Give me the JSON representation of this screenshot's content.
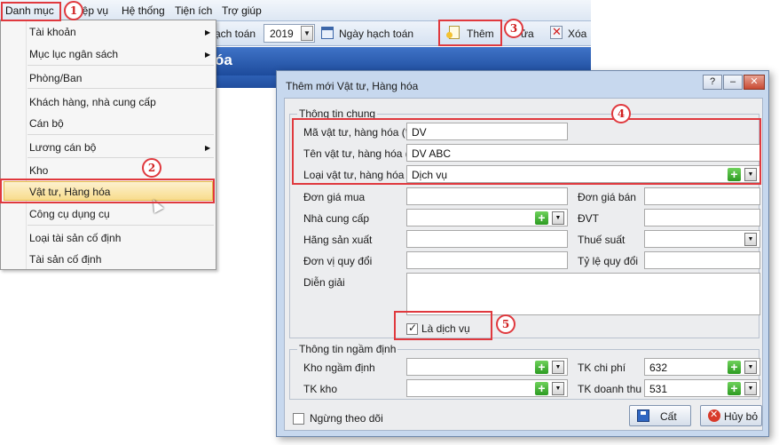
{
  "menubar": {
    "items": [
      "Danh mục",
      "Nghiệp vụ",
      "Hệ thống",
      "Tiện ích",
      "Trợ giúp"
    ],
    "nghiep_vu_visible": "iệp vụ"
  },
  "toolbar": {
    "year_label": "ạch toán",
    "year_value": "2019",
    "ngay_hach_toan": "Ngày hạch toán",
    "add": "Thêm",
    "edit": "ửa",
    "delete": "Xóa"
  },
  "bluebar": {
    "title": "óa"
  },
  "dropdown": {
    "items": [
      {
        "label": "Tài khoản",
        "submenu": true
      },
      {
        "label": "Mục lục ngân sách",
        "submenu": true
      },
      {
        "label": "Phòng/Ban",
        "submenu": false
      },
      {
        "label": "Khách hàng, nhà cung cấp",
        "submenu": false
      },
      {
        "label": "Cán bộ",
        "submenu": false
      },
      {
        "label": "Lương cán bộ",
        "submenu": true
      },
      {
        "label": "Kho",
        "submenu": false
      },
      {
        "label": "Vật tư, Hàng hóa",
        "submenu": false
      },
      {
        "label": "Công cụ dụng cụ",
        "submenu": false
      },
      {
        "label": "Loại tài sản cố định",
        "submenu": false
      },
      {
        "label": "Tài sản cố định",
        "submenu": false
      }
    ],
    "submenu_arrow": "▶"
  },
  "callouts": [
    "1",
    "2",
    "3",
    "4",
    "5"
  ],
  "dialog": {
    "title": "Thêm mới Vật tư, Hàng hóa",
    "help": "?",
    "minimize": "–",
    "close": "✕",
    "general_group": "Thông tin chung",
    "fields": {
      "ma_label": "Mã vật tư, hàng hóa (*)",
      "ma_value": "DV",
      "ten_label": "Tên vật tư, hàng hóa (*)",
      "ten_value": "DV ABC",
      "loai_label": "Loại vật tư, hàng hóa (*)",
      "loai_value": "Dịch vụ",
      "don_gia_mua": "Đơn giá mua",
      "don_gia_ban": "Đơn giá bán",
      "nha_cung_cap": "Nhà cung cấp",
      "dvt": "ĐVT",
      "hang_san_xuat": "Hãng sản xuất",
      "thue_suat": "Thuế suất",
      "don_vi_quy_doi": "Đơn vị quy đổi",
      "ty_le_quy_doi": "Tỷ lệ quy đổi",
      "dien_giai": "Diễn giải",
      "la_dich_vu": "Là dịch vụ"
    },
    "default_group": "Thông tin ngầm định",
    "defaults": {
      "kho_ngam_dinh": "Kho ngầm định",
      "tk_kho": "TK kho",
      "tk_chi_phi": "TK chi phí",
      "tk_chi_phi_value": "632",
      "tk_doanh_thu": "TK doanh thu",
      "tk_doanh_thu_value": "531"
    },
    "ngung_theo_doi": "Ngừng theo dõi",
    "save": "Cất",
    "cancel": "Hủy bỏ"
  },
  "colors": {
    "callout": "#e0393e",
    "highlight": "#f8dc8d",
    "title_bar": "#2d60b5",
    "dialog_frame": "#c7d8ee"
  },
  "icons": [
    "calendar-icon",
    "add-document-icon",
    "delete-icon",
    "plus-icon",
    "dropdown-arrow-icon",
    "save-icon",
    "cancel-icon",
    "mouse-cursor-icon"
  ]
}
